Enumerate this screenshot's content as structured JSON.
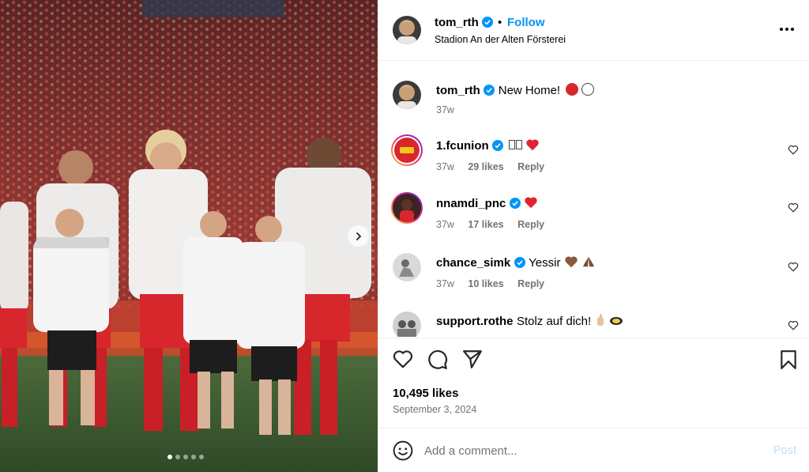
{
  "post": {
    "username": "tom_rth",
    "follow_label": "Follow",
    "location": "Stadion An der Alten Försterei",
    "caption_text": "New Home!",
    "caption_time": "37w"
  },
  "comments": [
    {
      "username": "1.fcunion",
      "text": "",
      "time": "37w",
      "likes": "29 likes",
      "reply": "Reply"
    },
    {
      "username": "nnamdi_pnc",
      "text": "",
      "time": "37w",
      "likes": "17 likes",
      "reply": "Reply"
    },
    {
      "username": "chance_simk",
      "text": "Yessir",
      "time": "37w",
      "likes": "10 likes",
      "reply": "Reply"
    },
    {
      "username": "support.rothe",
      "text": "Stolz auf dich!"
    }
  ],
  "likes_count": "10,495 likes",
  "post_date": "September 3, 2024",
  "comment_box": {
    "placeholder": "Add a comment...",
    "post_label": "Post"
  },
  "carousel": {
    "current": 1,
    "total": 5
  },
  "icons": {
    "verified": "verified-badge-icon",
    "like": "heart-icon",
    "comment": "comment-bubble-icon",
    "share": "paper-plane-icon",
    "save": "bookmark-icon",
    "emoji": "smiley-icon",
    "more": "more-options-icon",
    "next": "chevron-right-icon"
  },
  "colors": {
    "accent": "#0095f6",
    "union_red": "#d8262d",
    "muted": "#737373"
  }
}
